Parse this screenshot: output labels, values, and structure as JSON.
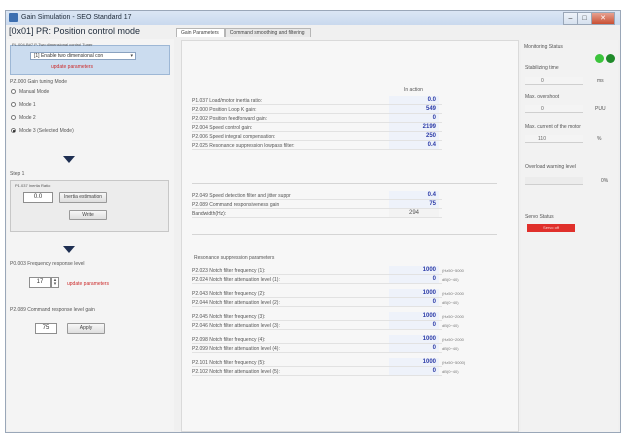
{
  "window": {
    "title": "Gain Simulation - SEO Standard 17",
    "buttons": {
      "minimize": "–",
      "maximize": "□",
      "close": "✕"
    }
  },
  "heading": "[0x01] PR: Position control mode",
  "left": {
    "top_label": "PL.004-B#7 P-Two dimensional control Tuner",
    "combo_value": "[1] Enable two dimensional con",
    "combo_arrow": "▾",
    "update_link": "update parameters",
    "mode_label": "PZ.000 Gain tuning Mode",
    "radios": [
      {
        "label": "Manual Mode",
        "selected": false
      },
      {
        "label": "Mode 1",
        "selected": false
      },
      {
        "label": "Mode 2",
        "selected": false
      },
      {
        "label": "Mode 3 (Selected Mode)",
        "selected": true
      }
    ],
    "step1_label": "Step 1",
    "inertia_label": "P1.037 Inertia Ratio",
    "inertia_value": "0.0",
    "inertia_button": "Inertia estimation",
    "write_button": "Write",
    "freq_label": "P0.003 Frequency response level",
    "freq_value": "17",
    "freq_update": "update parameters",
    "cmd_label": "P2.089 Command response level gain",
    "cmd_value": "75",
    "cmd_apply": "Apply"
  },
  "tabs": [
    {
      "label": "Gain Parameters",
      "active": true
    },
    {
      "label": "Command smoothing and filtering",
      "active": false
    }
  ],
  "main": {
    "col_header": "In action",
    "params1": [
      {
        "name": "P1.037 Load/motor inertia ratio:",
        "value": "0.0"
      },
      {
        "name": "P2.000 Position Loop K gain:",
        "value": "549"
      },
      {
        "name": "P2.002 Position feedforward gain:",
        "value": "0"
      },
      {
        "name": "P2.004 Speed control gain:",
        "value": "2199"
      },
      {
        "name": "P2.006 Speed integral compensation:",
        "value": "250"
      },
      {
        "name": "P2.025 Resonance suppression lowpass filter:",
        "value": "0.4"
      }
    ],
    "params2": [
      {
        "name": "P2.049 Speed detection filter and jitter suppr",
        "value": "0.4",
        "plain": false
      },
      {
        "name": "P2.089 Command responsiveness gain",
        "value": "75",
        "plain": false
      },
      {
        "name": "Bandwidth(Hz):",
        "value": "294",
        "plain": true
      }
    ],
    "resonance_title": "Resonance suppression parameters",
    "resonance": [
      {
        "name": "P2.023 Notch filter frequency (1):",
        "value": "1000",
        "unit": "(Hz50~5000"
      },
      {
        "name": "P2.024 Notch filter attenuation level (1):",
        "value": "0",
        "unit": "dB(0~40)"
      },
      {
        "name": "P2.043 Notch filter frequency (2):",
        "value": "1000",
        "unit": "(Hz50~2000"
      },
      {
        "name": "P2.044 Notch filter attenuation level (2):",
        "value": "0",
        "unit": "dB(0~40)"
      },
      {
        "name": "P2.045 Notch filter frequency (3):",
        "value": "1000",
        "unit": "(Hz50~2000"
      },
      {
        "name": "P2.046 Notch filter attenuation level (3):",
        "value": "0",
        "unit": "dB(0~40)"
      },
      {
        "name": "P2.098 Notch filter frequency (4):",
        "value": "1000",
        "unit": "(Hz50~2000"
      },
      {
        "name": "P2.099 Notch filter attenuation level (4):",
        "value": "0",
        "unit": "dB(0~40)"
      },
      {
        "name": "P2.101 Notch filter frequency (5):",
        "value": "1000",
        "unit": "(Hz50~5000)"
      },
      {
        "name": "P2.102 Notch filter attenuation level (5):",
        "value": "0",
        "unit": "dB(0~40)"
      }
    ]
  },
  "right": {
    "title": "Monitoring Status",
    "stabilizing_label": "Stabilizing time",
    "stabilizing_value": "0",
    "stabilizing_unit": "ms",
    "overshoot_label": "Max. overshoot",
    "overshoot_value": "0",
    "overshoot_unit": "PUU",
    "current_label": "Max. current of the motor",
    "current_value": "110",
    "current_unit": "%",
    "overload_label": "Overload warning level",
    "overload_unit": "0%",
    "servo_label": "Servo Status",
    "servo_status": "Servo off",
    "dot_colors": [
      "#3cc43c",
      "#1f8a2a"
    ],
    "status_color": "#e0302b"
  }
}
